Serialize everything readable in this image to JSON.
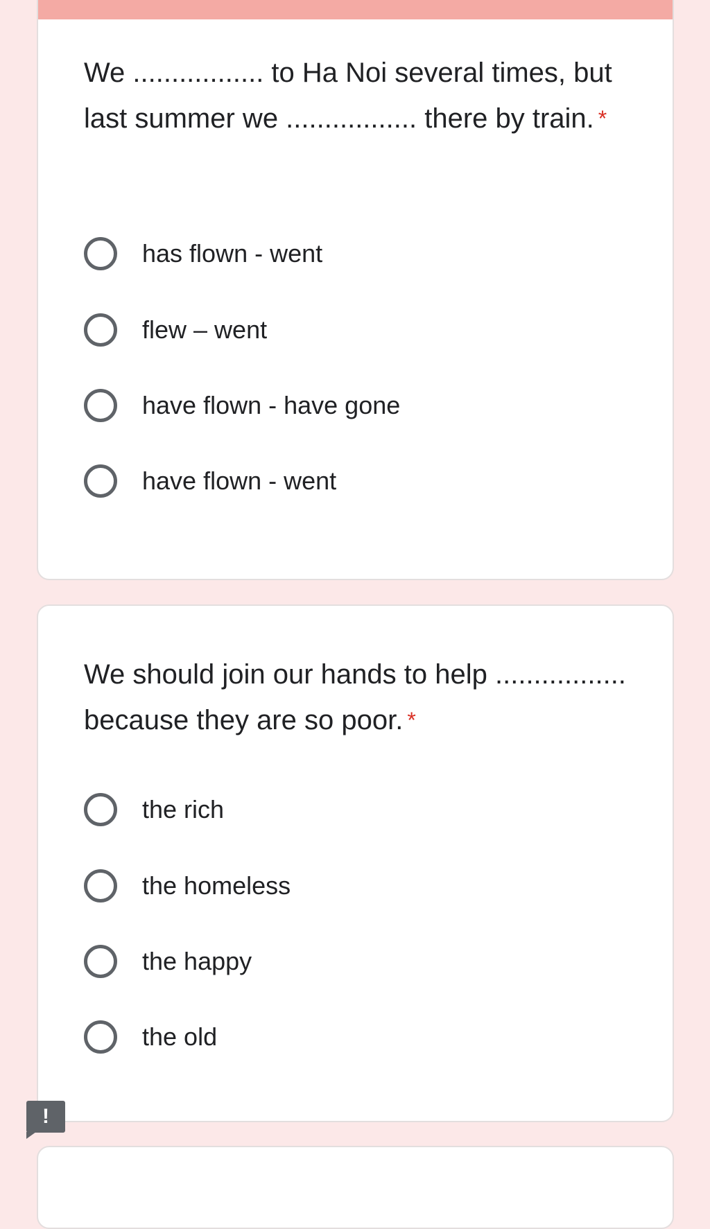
{
  "form": {
    "questions": [
      {
        "text": "We ................. to Ha Noi several times, but last summer we ................. there by train.",
        "required_marker": "*",
        "options": [
          "has flown - went",
          "flew – went",
          "have flown - have gone",
          "have flown - went"
        ]
      },
      {
        "text": "We should join our hands to help ................. because they are so poor.",
        "required_marker": "*",
        "options": [
          "the rich",
          "the homeless",
          "the happy",
          "the old"
        ]
      }
    ],
    "alert_badge": "!"
  },
  "colors": {
    "page_background": "#fce8e8",
    "header_accent": "#f4aaa4",
    "required_marker": "#d93025",
    "radio_outline": "#5f6368"
  },
  "icons": {
    "radio": "radio-unchecked-icon",
    "alert": "exclamation-badge-icon"
  }
}
